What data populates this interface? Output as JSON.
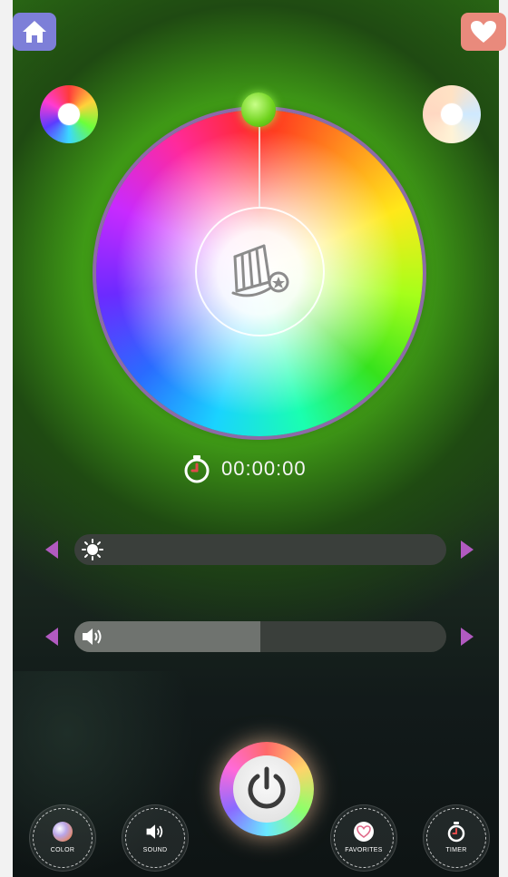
{
  "timer": {
    "value": "00:00:00"
  },
  "sliders": {
    "brightness": {
      "level": 0.0
    },
    "volume": {
      "level": 0.5
    }
  },
  "nav": {
    "items": [
      {
        "label": "COLOR",
        "icon": "color-ball-icon"
      },
      {
        "label": "SOUND",
        "icon": "speaker-icon"
      },
      {
        "label": "FAVORITES",
        "icon": "heart-star-icon"
      },
      {
        "label": "TIMER",
        "icon": "stopwatch-icon"
      }
    ]
  },
  "colors": {
    "home_button": "#7d7fd8",
    "favorite_button": "#e98a7c",
    "selected_color": "#6ed21c",
    "arrow_accent": "#b15ac0"
  }
}
